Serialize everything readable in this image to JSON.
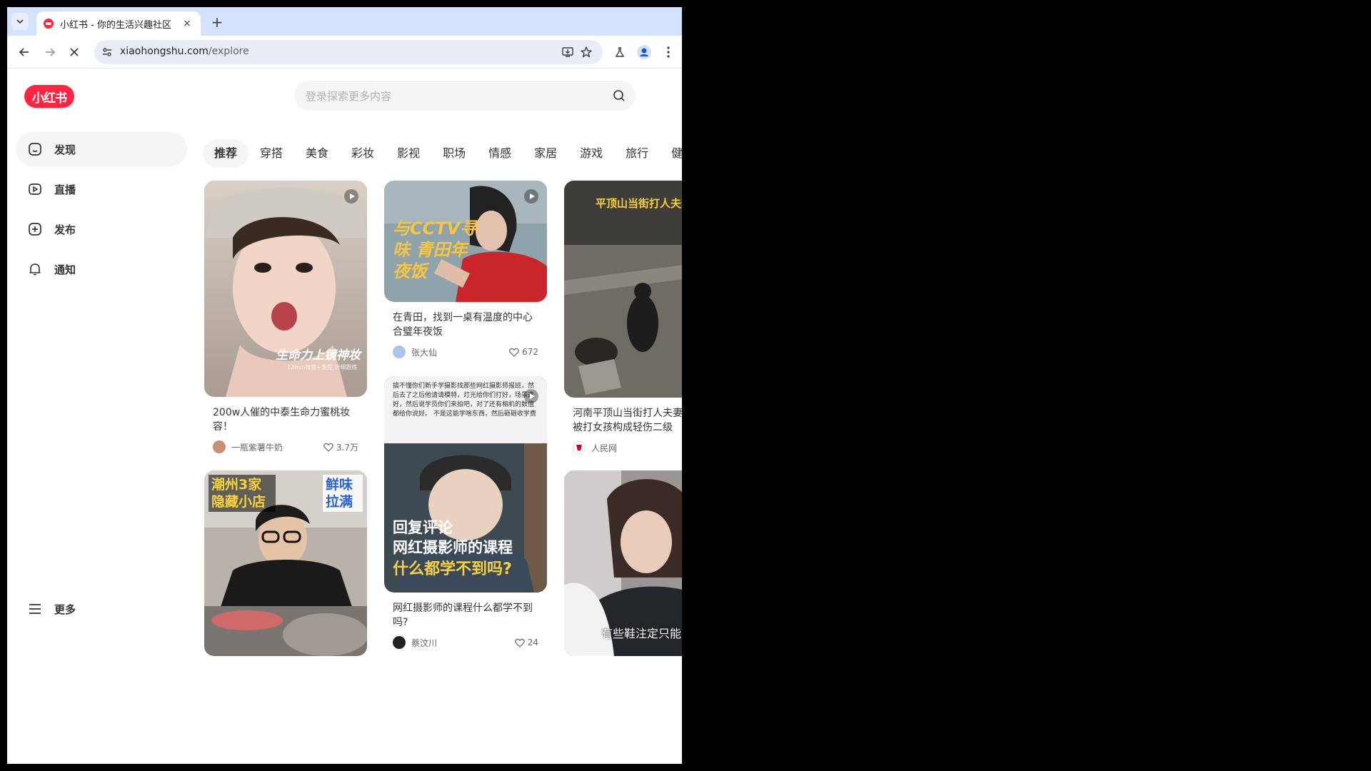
{
  "browser": {
    "tab_title": "小红书 - 你的生活兴趣社区",
    "tab_close": "×",
    "new_tab": "+",
    "url_domain": "xiaohongshu.com",
    "url_path": "/explore"
  },
  "header": {
    "logo_text": "小红书",
    "search_placeholder": "登录探索更多内容"
  },
  "sidebar": {
    "items": [
      {
        "label": "发现",
        "icon": "home-icon",
        "active": true
      },
      {
        "label": "直播",
        "icon": "live-icon"
      },
      {
        "label": "发布",
        "icon": "publish-plus-icon"
      },
      {
        "label": "通知",
        "icon": "bell-icon"
      }
    ],
    "more_label": "更多"
  },
  "channels": [
    "推荐",
    "穿搭",
    "美食",
    "彩妆",
    "影视",
    "职场",
    "情感",
    "家居",
    "游戏",
    "旅行",
    "健身"
  ],
  "cards": [
    {
      "title": "200w人催的中泰生命力蜜桃妆容！",
      "author": "一瓶紫薯牛奶",
      "likes": "3.7万",
      "overlay": "生命力上镜神妆",
      "overlay_sub": "12min妆容+发型 详细跟练"
    },
    {
      "title": "在青田，找到一桌有温度的中心合璧年夜饭",
      "author": "张大仙",
      "likes": "672",
      "overlay": "与CCTV寻味 青田年夜饭"
    },
    {
      "title": "河南平顶山当街打人夫妻被捕！被打女孩构成轻伤二级",
      "author": "人民网",
      "likes": "",
      "overlay": "平顶山当街打人夫妻被批捕"
    },
    {
      "title": "",
      "author": "",
      "likes": "",
      "overlay_left": "潮州3家 隐藏小店",
      "overlay_right": "鲜味 拉满"
    },
    {
      "title": "网红摄影师的课程什么都学不到吗?",
      "author": "蔡汶川",
      "likes": "24",
      "overlay_top": "搞不懂你们新手学摄影找那些网红摄影师报班，然后去了之后他请请模特，灯光给你们打好，场景选好，然后说学员你们来拍吧，对了还有相机的数值都给你说好。 不是这能学啥东西，然后砸砸收学费",
      "overlay_line1": "回复评论",
      "overlay_line2": "网红摄影师的课程",
      "overlay_line3": "什么都学不到吗?"
    },
    {
      "title": "",
      "author": "",
      "likes": "",
      "overlay": "有些鞋注定只能陪你走过一季风雨"
    }
  ],
  "colors": {
    "brand": "#ff2442",
    "tab_strip": "#d3e3fd",
    "omnibox": "#e9eef6"
  }
}
